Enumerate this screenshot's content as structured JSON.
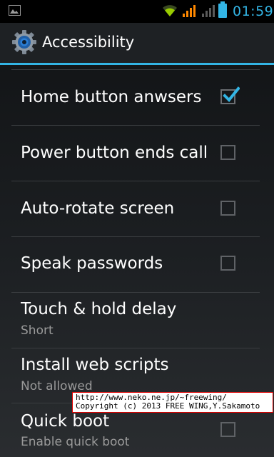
{
  "status_bar": {
    "time": "01:59",
    "icons": [
      "gallery-notification-icon",
      "wifi-icon",
      "signal-icon",
      "signal-icon",
      "battery-icon"
    ],
    "accent": "#33b5e5"
  },
  "action_bar": {
    "title": "Accessibility",
    "icon": "settings-gear-icon"
  },
  "settings": [
    {
      "title": "Home button anwsers c",
      "subtitle": "",
      "checked": true,
      "has_checkbox": true
    },
    {
      "title": "Power button ends call",
      "subtitle": "",
      "checked": false,
      "has_checkbox": true
    },
    {
      "title": "Auto-rotate screen",
      "subtitle": "",
      "checked": false,
      "has_checkbox": true
    },
    {
      "title": "Speak passwords",
      "subtitle": "",
      "checked": false,
      "has_checkbox": true
    },
    {
      "title": "Touch & hold delay",
      "subtitle": "Short",
      "has_checkbox": false
    },
    {
      "title": "Install web scripts",
      "subtitle": "Not allowed",
      "has_checkbox": false
    },
    {
      "title": "Quick boot",
      "subtitle": "Enable quick boot",
      "checked": false,
      "has_checkbox": true
    }
  ],
  "watermark": {
    "line1": "http://www.neko.ne.jp/~freewing/",
    "line2": "Copyright (c) 2013 FREE WING,Y.Sakamoto"
  }
}
